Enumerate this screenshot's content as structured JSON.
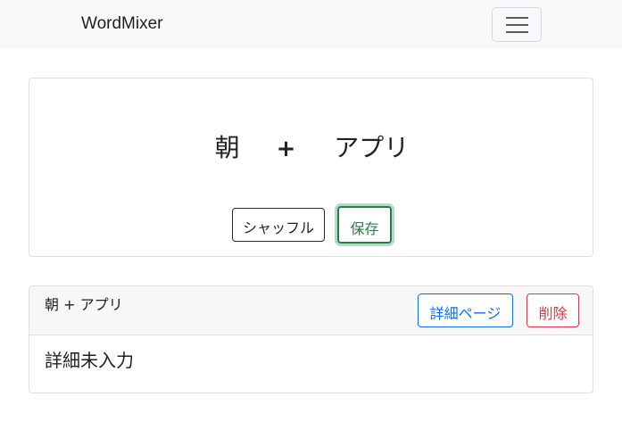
{
  "navbar": {
    "brand": "WordMixer",
    "toggler_icon": "hamburger-icon"
  },
  "mixer": {
    "word1": "朝",
    "plus": "+",
    "word2": "アプリ",
    "shuffle_label": "シャッフル",
    "save_label": "保存"
  },
  "saved": {
    "title": "朝 + アプリ",
    "detail_label": "詳細ページ",
    "delete_label": "削除",
    "body": "詳細未入力"
  },
  "colors": {
    "navbar_bg": "#f8f9fa",
    "save_green": "#2d7a4a",
    "detail_blue": "#0d6efd",
    "delete_red": "#dc3545"
  }
}
